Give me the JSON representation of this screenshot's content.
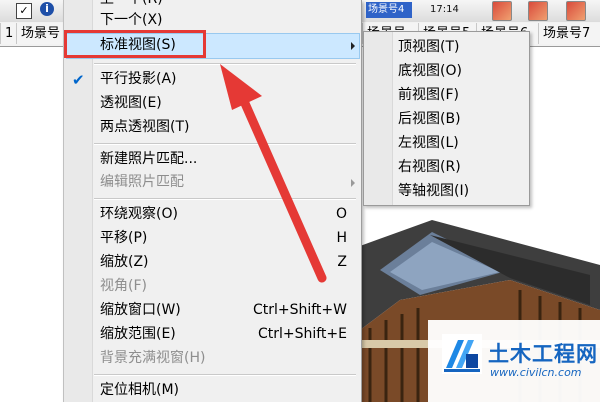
{
  "toolbar": {
    "view_tab_label": "场景号4",
    "time_label": "17:14"
  },
  "scene_tabs": [
    "1",
    "场景号",
    "场景号",
    "场景号5",
    "场景号6",
    "场景号7"
  ],
  "menu": {
    "items": [
      {
        "label": "上一个(R)",
        "disabled": false
      },
      {
        "label": "下一个(X)",
        "disabled": false
      },
      {
        "label": "标准视图(S)",
        "disabled": false,
        "submenu": true
      },
      {
        "label": "平行投影(A)",
        "disabled": false,
        "checked": true
      },
      {
        "label": "透视图(E)",
        "disabled": false
      },
      {
        "label": "两点透视图(T)",
        "disabled": false
      },
      {
        "label": "新建照片匹配...",
        "disabled": false
      },
      {
        "label": "编辑照片匹配",
        "disabled": true,
        "submenu": true
      },
      {
        "label": "环绕观察(O)",
        "disabled": false,
        "shortcut": "O"
      },
      {
        "label": "平移(P)",
        "disabled": false,
        "shortcut": "H"
      },
      {
        "label": "缩放(Z)",
        "disabled": false,
        "shortcut": "Z"
      },
      {
        "label": "视角(F)",
        "disabled": true
      },
      {
        "label": "缩放窗口(W)",
        "disabled": false,
        "shortcut": "Ctrl+Shift+W"
      },
      {
        "label": "缩放范围(E)",
        "disabled": false,
        "shortcut": "Ctrl+Shift+E"
      },
      {
        "label": "背景充满视窗(H)",
        "disabled": true
      },
      {
        "label": "定位相机(M)",
        "disabled": false
      }
    ]
  },
  "submenu": {
    "items": [
      "顶视图(T)",
      "底视图(O)",
      "前视图(F)",
      "后视图(B)",
      "左视图(L)",
      "右视图(R)",
      "等轴视图(I)"
    ]
  },
  "watermark": {
    "name": "土木工程网",
    "url": "www.civilcn.com"
  },
  "colors": {
    "annotation_red": "#e53935",
    "highlight": "#cce8ff",
    "brand_blue": "#1565c0"
  }
}
